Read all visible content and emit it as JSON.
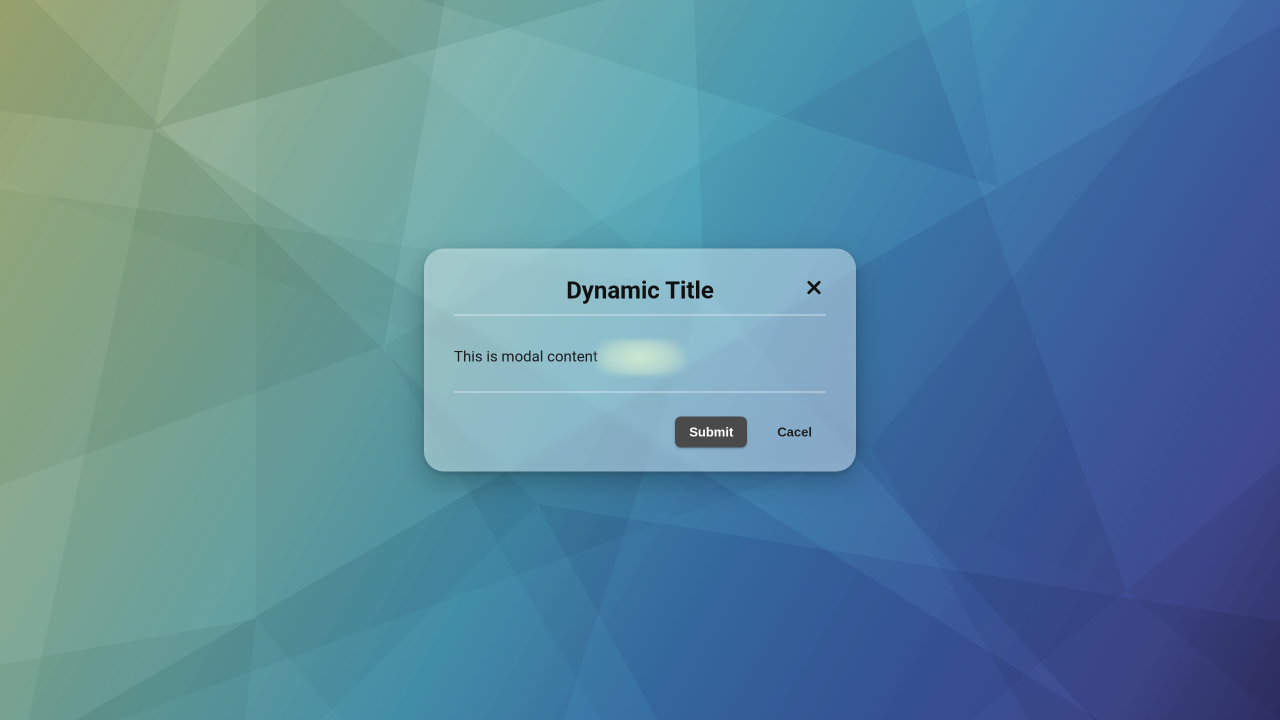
{
  "modal": {
    "title": "Dynamic Title",
    "body": "This is modal content",
    "blur_chip": "",
    "footer": {
      "submit": "Submit",
      "cancel": "Cacel"
    },
    "close_icon": "close-icon"
  }
}
